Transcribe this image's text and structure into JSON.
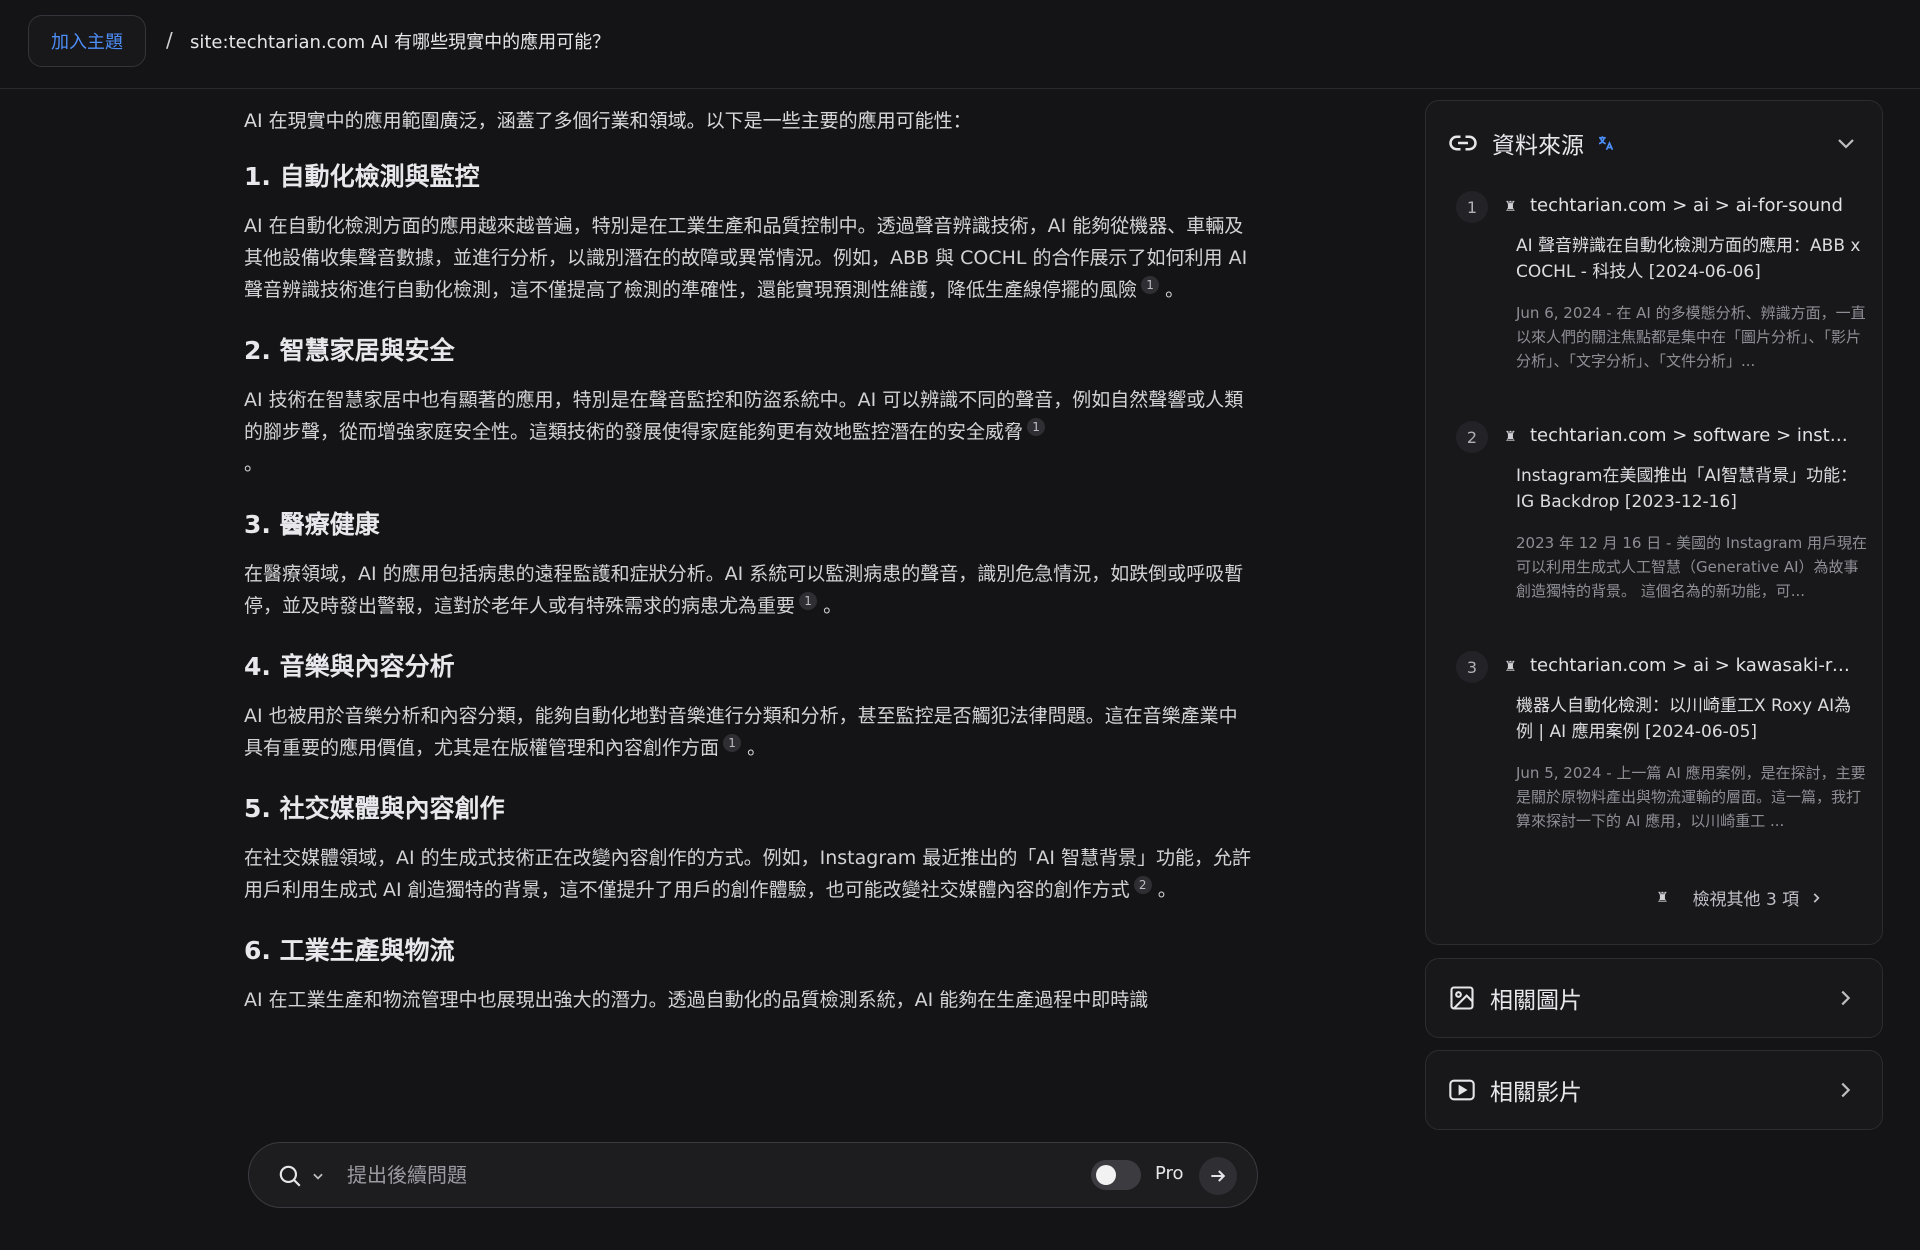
{
  "header": {
    "topic_button": "加入主題",
    "separator": "/",
    "query": "site:techtarian.com AI 有哪些現實中的應用可能？"
  },
  "answer": {
    "intro": "AI 在現實中的應用範圍廣泛，涵蓋了多個行業和領域。以下是一些主要的應用可能性：",
    "sections": [
      {
        "heading": "1. 自動化檢測與監控",
        "text": "AI 在自動化檢測方面的應用越來越普遍，特別是在工業生產和品質控制中。透過聲音辨識技術，AI 能夠從機器、車輛及其他設備收集聲音數據，並進行分析，以識別潛在的故障或異常情況。例如，ABB 與 COCHL 的合作展示了如何利用 AI 聲音辨識技術進行自動化檢測，這不僅提高了檢測的準確性，還能實現預測性維護，降低生產線停擺的風險",
        "cite": "1",
        "tail": "。"
      },
      {
        "heading": "2. 智慧家居與安全",
        "text": "AI 技術在智慧家居中也有顯著的應用，特別是在聲音監控和防盜系統中。AI 可以辨識不同的聲音，例如自然聲響或人類的腳步聲，從而增強家庭安全性。這類技術的發展使得家庭能夠更有效地監控潛在的安全威脅",
        "cite": "1",
        "tail": "。"
      },
      {
        "heading": "3. 醫療健康",
        "text": "在醫療領域，AI 的應用包括病患的遠程監護和症狀分析。AI 系統可以監測病患的聲音，識別危急情況，如跌倒或呼吸暫停，並及時發出警報，這對於老年人或有特殊需求的病患尤為重要",
        "cite": "1",
        "tail": "。"
      },
      {
        "heading": "4. 音樂與內容分析",
        "text": "AI 也被用於音樂分析和內容分類，能夠自動化地對音樂進行分類和分析，甚至監控是否觸犯法律問題。這在音樂產業中具有重要的應用價值，尤其是在版權管理和內容創作方面",
        "cite": "1",
        "tail": "。"
      },
      {
        "heading": "5. 社交媒體與內容創作",
        "text": "在社交媒體領域，AI 的生成式技術正在改變內容創作的方式。例如，Instagram 最近推出的「AI 智慧背景」功能，允許用戶利用生成式 AI 創造獨特的背景，這不僅提升了用戶的創作體驗，也可能改變社交媒體內容的創作方式",
        "cite": "2",
        "tail": "。"
      },
      {
        "heading": "6. 工業生產與物流",
        "text": "AI 在工業生產和物流管理中也展現出強大的潛力。透過自動化的品質檢測系統，AI 能夠在生產過程中即時識",
        "cite": "",
        "tail": ""
      }
    ]
  },
  "followup": {
    "placeholder": "提出後續問題",
    "pro_label": "Pro"
  },
  "sources": {
    "title": "資料來源",
    "items": [
      {
        "num": "1",
        "site": "techtarian.com > ai > ai-for-sound",
        "title": "AI 聲音辨識在自動化檢測方面的應用：ABB x COCHL - 科技人 [2024-06-06]",
        "snippet": "Jun 6, 2024 - 在 AI 的多模態分析、辨識方面，一直以來人們的關注焦點都是集中在「圖片分析」、「影片分析」、「文字分析」、「文件分析」..."
      },
      {
        "num": "2",
        "site": "techtarian.com > software > instagr...",
        "title": "Instagram在美國推出「AI智慧背景」功能：IG Backdrop [2023-12-16]",
        "snippet": "2023 年 12 月 16 日 - 美國的 Instagram 用戶現在可以利用生成式人工智慧（Generative AI）為故事創造獨特的背景。 這個名為的新功能，可..."
      },
      {
        "num": "3",
        "site": "techtarian.com > ai > kawasaki-rox...",
        "title": "機器人自動化檢測：以川崎重工X Roxy AI為例 | AI 應用案例 [2024-06-05]",
        "snippet": "Jun 5, 2024 - 上一篇 AI 應用案例，是在探討，主要是關於原物料產出與物流運輸的層面。這一篇，我打算來探討一下的 AI 應用，以川崎重工 ..."
      }
    ],
    "see_more": "檢視其他 3 項"
  },
  "related_images": {
    "label": "相關圖片"
  },
  "related_videos": {
    "label": "相關影片"
  },
  "colors": {
    "background": "#141416",
    "accent": "#4d8ef7",
    "panel": "#18181b"
  }
}
